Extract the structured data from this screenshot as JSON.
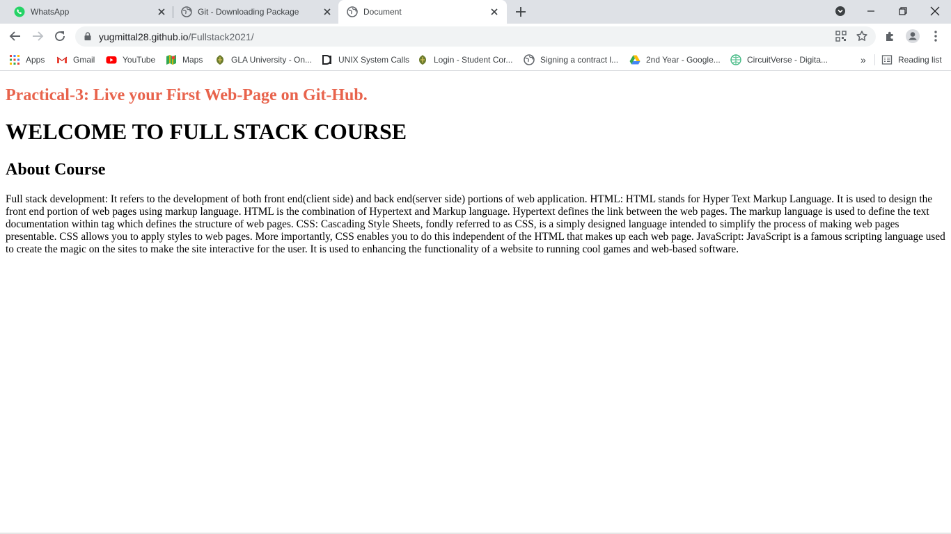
{
  "browser": {
    "tabs": [
      {
        "title": "WhatsApp",
        "icon": "whatsapp-icon",
        "active": false
      },
      {
        "title": "Git - Downloading Package",
        "icon": "globe-icon",
        "active": false
      },
      {
        "title": "Document",
        "icon": "globe-icon",
        "active": true
      }
    ],
    "address": {
      "host": "yugmittal28.github.io",
      "path": "/Fullstack2021/"
    },
    "bookmarks": [
      {
        "label": "Apps",
        "icon": "apps-grid-icon"
      },
      {
        "label": "Gmail",
        "icon": "gmail-icon"
      },
      {
        "label": "YouTube",
        "icon": "youtube-icon"
      },
      {
        "label": "Maps",
        "icon": "maps-icon"
      },
      {
        "label": "GLA University - On...",
        "icon": "gla-logo-icon"
      },
      {
        "label": "UNIX System Calls",
        "icon": "unix-icon"
      },
      {
        "label": "Login - Student Cor...",
        "icon": "gla-logo-icon"
      },
      {
        "label": "Signing a contract l...",
        "icon": "globe-icon"
      },
      {
        "label": "2nd Year - Google...",
        "icon": "google-drive-icon"
      },
      {
        "label": "CircuitVerse - Digita...",
        "icon": "circuitverse-icon"
      }
    ],
    "reading_list_label": "Reading list",
    "more_bookmarks": "»"
  },
  "page": {
    "practical_heading": "Practical-3: Live your First Web-Page on Git-Hub.",
    "main_heading": "WELCOME TO FULL STACK COURSE",
    "about_heading": "About Course",
    "about_text": "Full stack development: It refers to the development of both front end(client side) and back end(server side) portions of web application. HTML: HTML stands for Hyper Text Markup Language. It is used to design the front end portion of web pages using markup language. HTML is the combination of Hypertext and Markup language. Hypertext defines the link between the web pages. The markup language is used to define the text documentation within tag which defines the structure of web pages. CSS: Cascading Style Sheets, fondly referred to as CSS, is a simply designed language intended to simplify the process of making web pages presentable. CSS allows you to apply styles to web pages. More importantly, CSS enables you to do this independent of the HTML that makes up each web page. JavaScript: JavaScript is a famous scripting language used to create the magic on the sites to make the site interactive for the user. It is used to enhancing the functionality of a website to running cool games and web-based software."
  },
  "colors": {
    "practical_heading": "#e8634c",
    "tabstrip_bg": "#dee1e6",
    "omnibox_bg": "#f1f3f4"
  }
}
